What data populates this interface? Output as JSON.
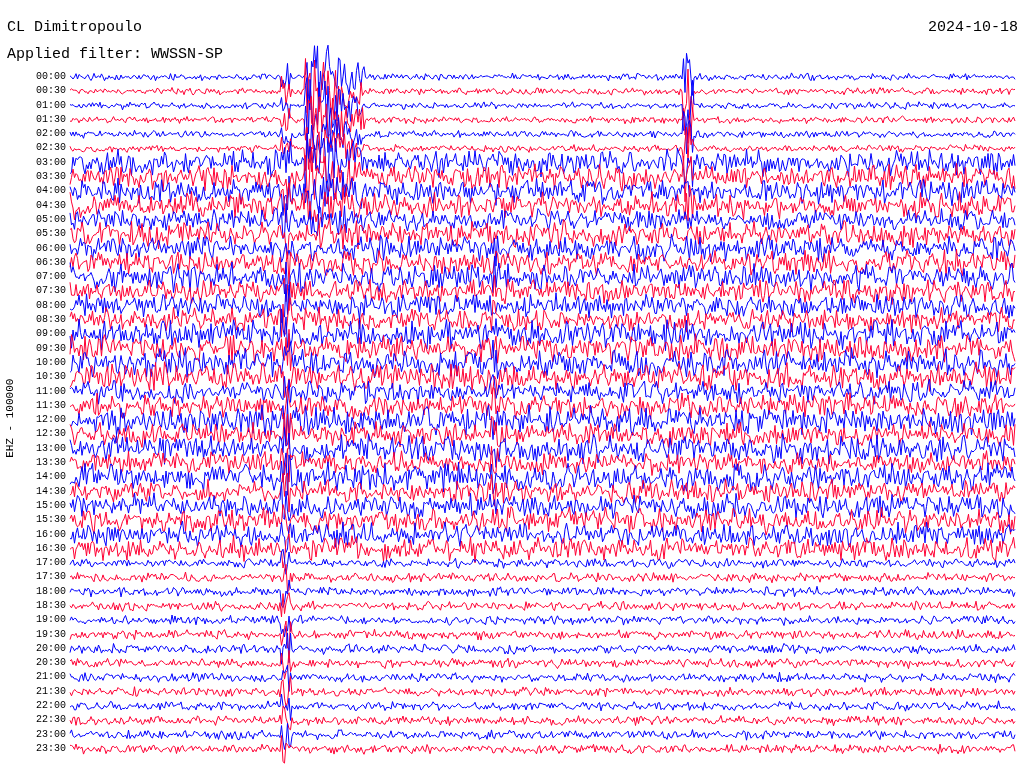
{
  "title": "CL Dimitropoulo",
  "date": "2024-10-18",
  "filter": "Applied filter: WWSSN-SP",
  "channel_label": "EHZ - 100000",
  "traces": [
    {
      "time": "00:00",
      "color": "#0000ff"
    },
    {
      "time": "00:30",
      "color": "#ff0033"
    },
    {
      "time": "01:00",
      "color": "#0000ff"
    },
    {
      "time": "01:30",
      "color": "#ff0033"
    },
    {
      "time": "02:00",
      "color": "#0000ff"
    },
    {
      "time": "02:30",
      "color": "#ff0033"
    },
    {
      "time": "03:00",
      "color": "#0000ff"
    },
    {
      "time": "03:30",
      "color": "#ff0033"
    },
    {
      "time": "04:00",
      "color": "#0000ff"
    },
    {
      "time": "04:30",
      "color": "#ff0033"
    },
    {
      "time": "05:00",
      "color": "#0000ff"
    },
    {
      "time": "05:30",
      "color": "#ff0033"
    },
    {
      "time": "06:00",
      "color": "#0000ff"
    },
    {
      "time": "06:30",
      "color": "#ff0033"
    },
    {
      "time": "07:00",
      "color": "#0000ff"
    },
    {
      "time": "07:30",
      "color": "#ff0033"
    },
    {
      "time": "08:00",
      "color": "#0000ff"
    },
    {
      "time": "08:30",
      "color": "#ff0033"
    },
    {
      "time": "09:00",
      "color": "#0000ff"
    },
    {
      "time": "09:30",
      "color": "#ff0033"
    },
    {
      "time": "10:00",
      "color": "#0000ff"
    },
    {
      "time": "10:30",
      "color": "#ff0033"
    },
    {
      "time": "11:00",
      "color": "#0000ff"
    },
    {
      "time": "11:30",
      "color": "#ff0033"
    },
    {
      "time": "12:00",
      "color": "#0000ff"
    },
    {
      "time": "12:30",
      "color": "#ff0033"
    },
    {
      "time": "13:00",
      "color": "#0000ff"
    },
    {
      "time": "13:30",
      "color": "#ff0033"
    },
    {
      "time": "14:00",
      "color": "#0000ff"
    },
    {
      "time": "14:30",
      "color": "#ff0033"
    },
    {
      "time": "15:00",
      "color": "#0000ff"
    },
    {
      "time": "15:30",
      "color": "#ff0033"
    },
    {
      "time": "16:00",
      "color": "#0000ff"
    },
    {
      "time": "16:30",
      "color": "#ff0033"
    },
    {
      "time": "17:00",
      "color": "#0000ff"
    },
    {
      "time": "17:30",
      "color": "#ff0033"
    },
    {
      "time": "18:00",
      "color": "#0000ff"
    },
    {
      "time": "18:30",
      "color": "#ff0033"
    },
    {
      "time": "19:00",
      "color": "#0000ff"
    },
    {
      "time": "19:30",
      "color": "#ff0033"
    },
    {
      "time": "20:00",
      "color": "#0000ff"
    },
    {
      "time": "20:30",
      "color": "#ff0033"
    },
    {
      "time": "21:00",
      "color": "#0000ff"
    },
    {
      "time": "21:30",
      "color": "#ff0033"
    },
    {
      "time": "22:00",
      "color": "#0000ff"
    },
    {
      "time": "22:30",
      "color": "#ff0033"
    },
    {
      "time": "23:00",
      "color": "#0000ff"
    },
    {
      "time": "23:30",
      "color": "#ff0033"
    }
  ]
}
